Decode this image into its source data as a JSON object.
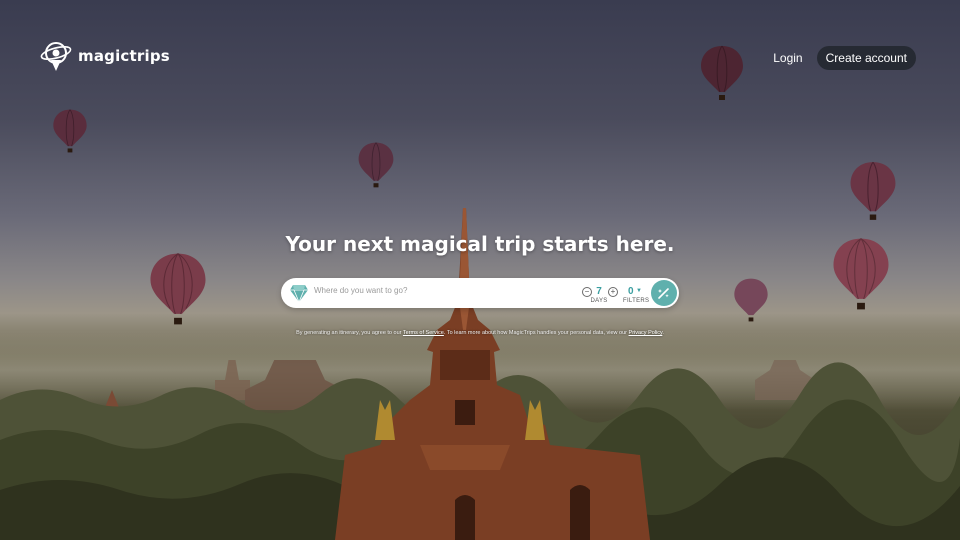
{
  "brand": {
    "name": "magictrips"
  },
  "nav": {
    "login": "Login",
    "create_account": "Create account"
  },
  "hero": {
    "headline": "Your next magical trip starts here."
  },
  "search": {
    "placeholder": "Where do you want to go?",
    "days_value": "7",
    "days_label": "DAYS",
    "filters_value": "0",
    "filters_label": "FILTERS",
    "decrement_symbol": "−",
    "increment_symbol": "+"
  },
  "legal": {
    "part1": "By generating an itinerary, you agree to our ",
    "terms_link": "Terms of Service",
    "part2": ". To learn more about how MagicTrips handles your personal data, view our ",
    "privacy_link": "Privacy Policy",
    "part3": "."
  },
  "colors": {
    "accent": "#5fb0ad",
    "accent_text": "#3a9ea0",
    "button_dark": "#262a33",
    "balloon": "#5a2e38"
  },
  "icons": {
    "logo": "globe-pin-icon",
    "search_gem": "diamond-icon",
    "go": "magic-wand-icon",
    "balloon": "hot-air-balloon"
  }
}
